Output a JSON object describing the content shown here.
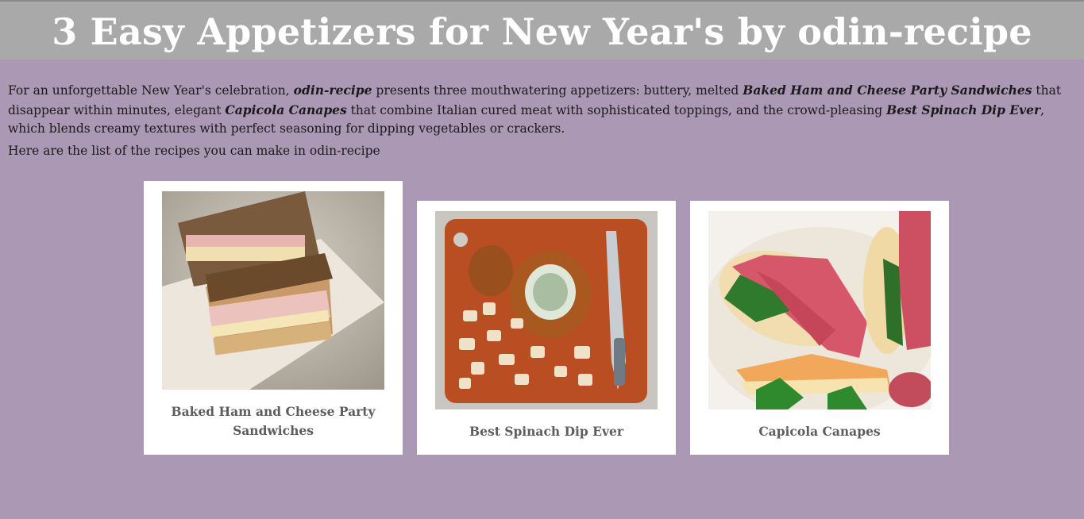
{
  "page": {
    "title": "3 Easy Appetizers for New Year's by odin-recipe",
    "intro": {
      "t1": "For an unforgettable New Year's celebration, ",
      "b1": "odin-recipe",
      "t2": " presents three mouthwatering appetizers: buttery, melted ",
      "b2": "Baked Ham and Cheese Party Sandwiches",
      "t3": " that disappear within minutes, elegant ",
      "b3": "Capicola Canapes",
      "t4": " that combine Italian cured meat with sophisticated toppings, and the crowd-pleasing ",
      "b4": "Best Spinach Dip Ever",
      "t5": ", which blends creamy textures with perfect seasoning for dipping vegetables or crackers."
    },
    "list_line": "Here are the list of the recipes you can make in odin-recipe"
  },
  "recipes": [
    {
      "name": "Baked Ham and Cheese Party Sandwiches",
      "image": "ham-cheese-sandwich-photo"
    },
    {
      "name": "Best Spinach Dip Ever",
      "image": "spinach-dip-bread-bowl-photo"
    },
    {
      "name": "Capicola Canapes",
      "image": "capicola-canapes-photo"
    }
  ],
  "colors": {
    "background": "#ab98b4",
    "banner": "#a9a9a9",
    "card": "#ffffff",
    "caption": "#5d5d5d"
  }
}
